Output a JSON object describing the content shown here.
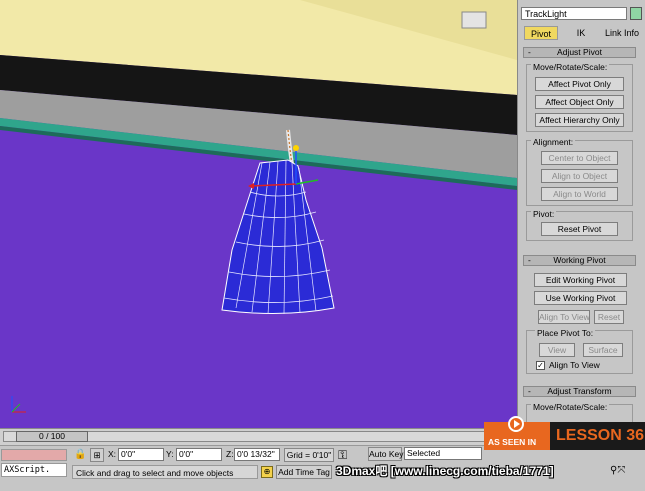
{
  "command_panel": {
    "object_name": "TrackLight",
    "object_color": "#8fd6a4",
    "tabs": [
      "Pivot",
      "IK",
      "Link Info"
    ],
    "active_tab": "Pivot",
    "adjust_pivot": {
      "title": "Adjust Pivot",
      "sign": "-",
      "move_rotate_scale_label": "Move/Rotate/Scale:",
      "affect_pivot_only": "Affect Pivot Only",
      "affect_object_only": "Affect Object Only",
      "affect_hierarchy_only": "Affect Hierarchy Only",
      "alignment_label": "Alignment:",
      "center_to_object": "Center to Object",
      "align_to_object": "Align to Object",
      "align_to_world": "Align to World",
      "pivot_label": "Pivot:",
      "reset_pivot": "Reset Pivot"
    },
    "working_pivot": {
      "title": "Working Pivot",
      "sign": "-",
      "edit_working_pivot": "Edit Working Pivot",
      "use_working_pivot": "Use Working Pivot",
      "align_to_view": "Align To View",
      "reset": "Reset",
      "place_pivot_to_label": "Place Pivot To:",
      "view": "View",
      "surface": "Surface",
      "align_to_view_checkbox": "Align To View",
      "align_to_view_checked": true
    },
    "adjust_transform": {
      "title": "Adjust Transform",
      "sign": "-",
      "move_rotate_scale_label": "Move/Rotate/Scale:"
    }
  },
  "timeline": {
    "frame_readout": "0 / 100"
  },
  "statusbar": {
    "x_label": "X:",
    "x_value": "0'0\"",
    "y_label": "Y:",
    "y_value": "0'0\"",
    "z_label": "Z:",
    "z_value": "0'0 13/32\"",
    "grid": "Grid = 0'10\"",
    "auto_key": "Auto Key",
    "selected_option": "Selected",
    "add_time_tag": "Add Time Tag",
    "maxscript_text": "AXScript.",
    "prompt": "Click and drag to select and move objects"
  },
  "overlay": {
    "as_seen_in": "AS SEEN IN",
    "lesson": "LESSON 36",
    "watermark": "3Dmax吧 [www.linecg.com/tieba/1771]"
  },
  "colors": {
    "viewport_background": "#6a36c8",
    "lamp_shade": "#2b2bd6",
    "active_tab": "#f0d860",
    "ceiling_yellow": "#f2e9a8",
    "track_teal": "#2fa58c",
    "lesson_orange": "#e8671f"
  }
}
